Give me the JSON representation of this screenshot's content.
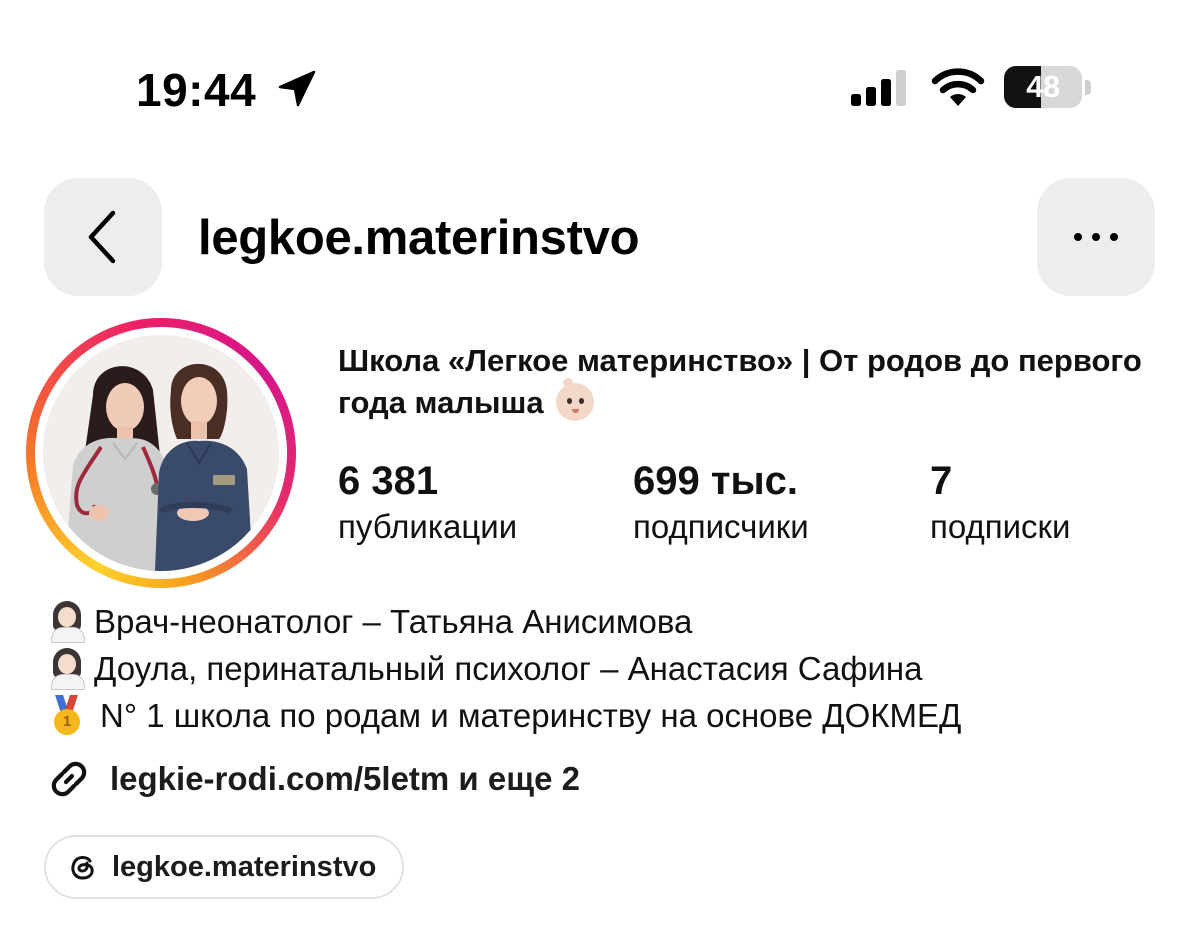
{
  "status_bar": {
    "time": "19:44",
    "battery_percent": 48,
    "battery_label": "48",
    "icons": [
      "location-arrow-icon",
      "cellular-signal-icon",
      "wifi-icon",
      "battery-icon"
    ]
  },
  "nav": {
    "username": "legkoe.materinstvo",
    "back_icon": "chevron-left-icon",
    "more_icon": "ellipsis-icon"
  },
  "profile": {
    "display_name": "Школа «Легкое материнство» | От родов до первого года малыша",
    "display_name_emoji": "baby-emoji",
    "avatar_ring_colors": [
      "#fdd22d",
      "#f57a26",
      "#ee1f68",
      "#d5158b"
    ]
  },
  "stats": {
    "posts": {
      "value": "6 381",
      "label": "публикации"
    },
    "followers": {
      "value": "699 тыс.",
      "label": "подписчики"
    },
    "following": {
      "value": "7",
      "label": "подписки"
    }
  },
  "bio": {
    "line1": "Врач-неонатолог – Татьяна Анисимова",
    "line2": "Доула, перинатальный психолог – Анастасия Сафина",
    "line3": "N° 1 школа по родам и материнству на основе ДОКМЕД",
    "line_emojis": [
      "woman-doctor-emoji",
      "woman-doctor-emoji",
      "first-place-medal-emoji"
    ]
  },
  "link": {
    "text": "legkie-rodi.com/5letm и еще 2",
    "icon": "link-icon"
  },
  "threads": {
    "label": "legkoe.materinstvo",
    "icon": "threads-icon"
  }
}
